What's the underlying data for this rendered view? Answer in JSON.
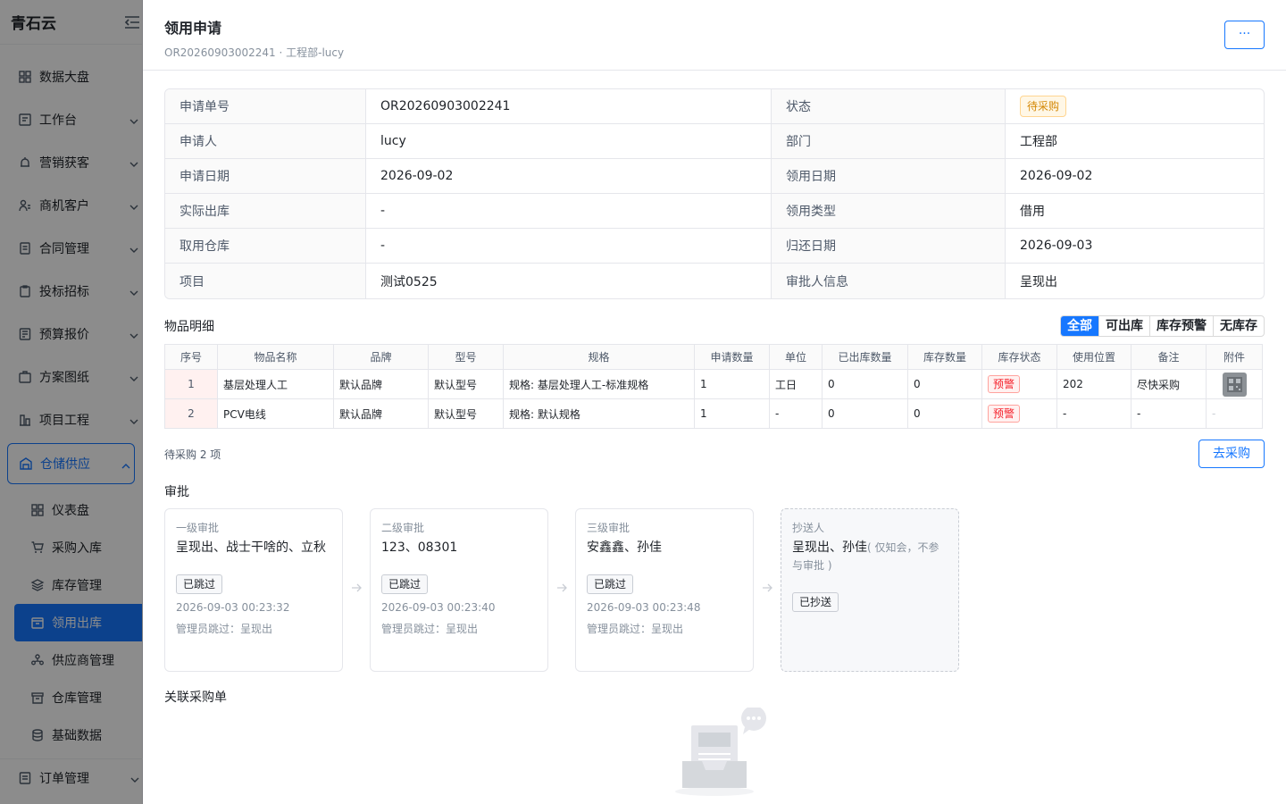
{
  "sidebar": {
    "brand": "青石云",
    "items": [
      {
        "label": "数据大盘",
        "icon": "dashboard-icon",
        "has_chevron": false
      },
      {
        "label": "工作台",
        "icon": "workbench-icon",
        "has_chevron": true
      },
      {
        "label": "营销获客",
        "icon": "marketing-icon",
        "has_chevron": true
      },
      {
        "label": "商机客户",
        "icon": "customer-icon",
        "has_chevron": true
      },
      {
        "label": "合同管理",
        "icon": "contract-icon",
        "has_chevron": true
      },
      {
        "label": "投标招标",
        "icon": "bid-icon",
        "has_chevron": true
      },
      {
        "label": "预算报价",
        "icon": "budget-icon",
        "has_chevron": true
      },
      {
        "label": "方案图纸",
        "icon": "drawing-icon",
        "has_chevron": true
      },
      {
        "label": "项目工程",
        "icon": "project-icon",
        "has_chevron": true
      }
    ],
    "open_group": {
      "label": "仓储供应",
      "icon": "warehouse-icon"
    },
    "sub_items": [
      {
        "label": "仪表盘",
        "icon": "dashboard-icon"
      },
      {
        "label": "采购入库",
        "icon": "cart-icon"
      },
      {
        "label": "库存管理",
        "icon": "layers-icon"
      },
      {
        "label": "领用出库",
        "icon": "outbound-icon",
        "active": true
      },
      {
        "label": "供应商管理",
        "icon": "supplier-icon"
      },
      {
        "label": "仓库管理",
        "icon": "archive-icon"
      },
      {
        "label": "基础数据",
        "icon": "database-icon"
      }
    ],
    "bottom_item": {
      "label": "订单管理",
      "icon": "order-icon"
    }
  },
  "drawer": {
    "title": "领用申请",
    "subtitle": "OR20260903002241 · 工程部-lucy",
    "more_label": "···"
  },
  "info": {
    "rows": [
      {
        "k1": "申请单号",
        "v1": "OR20260903002241",
        "k2": "状态",
        "v2": "待采购",
        "v2_tag": true
      },
      {
        "k1": "申请人",
        "v1": "lucy",
        "k2": "部门",
        "v2": "工程部"
      },
      {
        "k1": "申请日期",
        "v1": "2026-09-02",
        "k2": "领用日期",
        "v2": "2026-09-02"
      },
      {
        "k1": "实际出库",
        "v1": "-",
        "k2": "领用类型",
        "v2": "借用"
      },
      {
        "k1": "取用仓库",
        "v1": "-",
        "k2": "归还日期",
        "v2": "2026-09-03"
      },
      {
        "k1": "项目",
        "v1": "测试0525",
        "k2": "审批人信息",
        "v2": "呈现出"
      }
    ]
  },
  "items": {
    "title": "物品明细",
    "filters": [
      {
        "label": "全部",
        "active": true
      },
      {
        "label": "可出库"
      },
      {
        "label": "库存预警"
      },
      {
        "label": "无库存"
      }
    ],
    "columns": [
      "序号",
      "物品名称",
      "品牌",
      "型号",
      "规格",
      "申请数量",
      "单位",
      "已出库数量",
      "库存数量",
      "库存状态",
      "使用位置",
      "备注",
      "附件"
    ],
    "rows": [
      {
        "idx": "1",
        "name": "基层处理人工",
        "brand": "默认品牌",
        "model": "默认型号",
        "spec": "规格: 基层处理人工-标准规格",
        "qty": "1",
        "unit": "工日",
        "out": "0",
        "stock": "0",
        "status": "预警",
        "location": "202",
        "remark": "尽快采购",
        "attachment": "thumbnail"
      },
      {
        "idx": "2",
        "name": "PCV电线",
        "brand": "默认品牌",
        "model": "默认型号",
        "spec": "规格: 默认规格",
        "qty": "1",
        "unit": "-",
        "out": "0",
        "stock": "0",
        "status": "预警",
        "location": "-",
        "remark": "-",
        "attachment": "-"
      }
    ],
    "pending_text": "待采购 2 项",
    "go_button": "去采购"
  },
  "approval": {
    "title": "审批",
    "steps": [
      {
        "level": "一级审批",
        "names": "呈现出、战士干啥的、立秋",
        "tag": "已跳过",
        "time": "2026-09-03 00:23:32",
        "by": "管理员跳过：呈现出"
      },
      {
        "level": "二级审批",
        "names": "123、08301",
        "tag": "已跳过",
        "time": "2026-09-03 00:23:40",
        "by": "管理员跳过：呈现出"
      },
      {
        "level": "三级审批",
        "names": "安鑫鑫、孙佳",
        "tag": "已跳过",
        "time": "2026-09-03 00:23:48",
        "by": "管理员跳过：呈现出"
      }
    ],
    "cc": {
      "level": "抄送人",
      "names": "呈现出、孙佳",
      "note": "( 仅知会，不参与审批 )",
      "tag": "已抄送"
    }
  },
  "related": {
    "title": "关联采购单"
  },
  "colors": {
    "primary": "#1677ff",
    "warn": "#d48806",
    "danger": "#f5222d"
  }
}
